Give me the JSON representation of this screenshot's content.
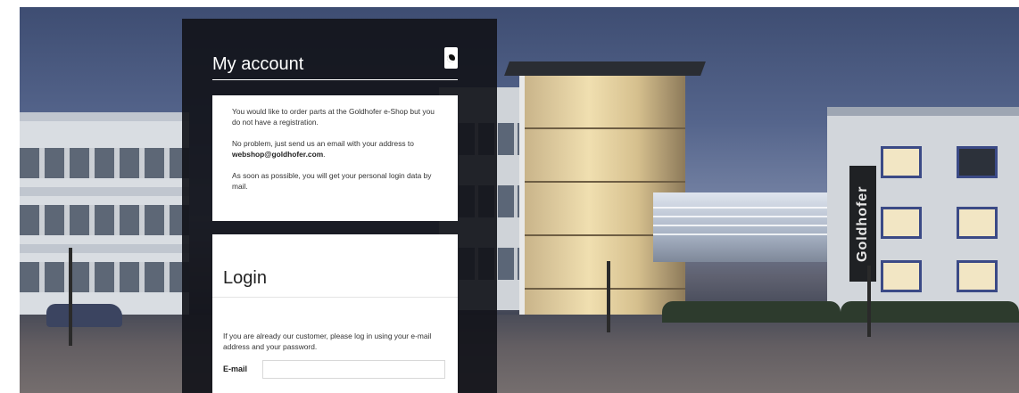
{
  "account": {
    "title": "My account",
    "info_icon": "info-icon",
    "info": {
      "p1": "You would like to order parts at the Goldhofer e-Shop but you do not have a registration.",
      "p2_prefix": "No problem, just send us an email with your address to ",
      "p2_email": "webshop@goldhofer.com",
      "p2_suffix": ".",
      "p3": "As soon as possible, you will get your personal login data by mail."
    }
  },
  "login": {
    "title": "Login",
    "text": "If you are already our customer, please log in using your e-mail address and your password.",
    "email_label": "E-mail",
    "email_value": "",
    "email_placeholder": ""
  },
  "background": {
    "brand_sign": "Goldhofer"
  },
  "colors": {
    "panel": "#12141a",
    "box": "#ffffff",
    "title_text": "#ffffff"
  }
}
